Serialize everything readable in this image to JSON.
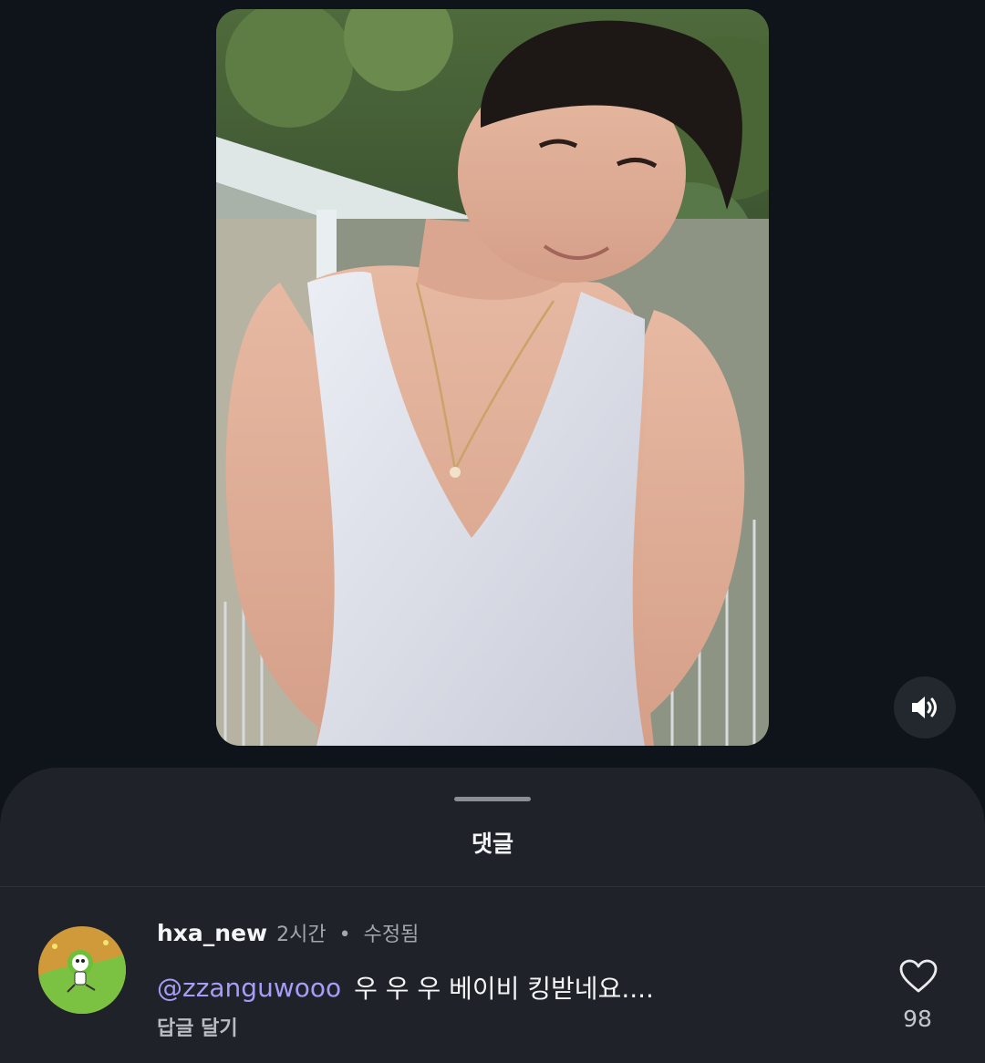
{
  "video": {
    "media": "vertical-video-thumbnail",
    "mute_icon": "speaker-volume-icon"
  },
  "comments_sheet": {
    "title": "댓글"
  },
  "comment": {
    "username": "hxa_new",
    "time": "2시간",
    "separator": "•",
    "edited_label": "수정됨",
    "mention": "@zzanguwooo",
    "text": "우 우 우 베이비 킹받네요....",
    "reply_label": "답글 달기",
    "like_icon": "heart-outline-icon",
    "like_count": "98",
    "avatar_icon": "cartoon-avatar-icon"
  },
  "colors": {
    "background": "#0f131a",
    "sheet": "#1f2228",
    "mention": "#a79cf8",
    "muted_text": "#a3a7ad"
  }
}
